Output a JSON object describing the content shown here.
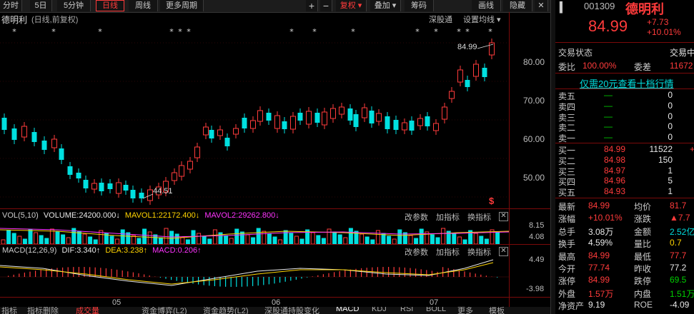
{
  "toolbar": {
    "buttons": [
      "分时",
      "5日",
      "5分钟",
      "日线",
      "周线",
      "更多周期"
    ],
    "plus": "+",
    "minus": "−",
    "right_buttons": [
      "复权",
      "叠加",
      "筹码",
      "画线",
      "隐藏"
    ],
    "close": "✕"
  },
  "chart_header": {
    "name": "德明利",
    "mode": "(日线,前复权)",
    "shenguo": "深股通",
    "set_ma": "设置均线"
  },
  "price_axis": [
    "80.00",
    "70.00",
    "60.00",
    "50.00"
  ],
  "annotations": {
    "high": "84.99",
    "low": "44.51",
    "marker_glyph": "*",
    "right_marker": "$"
  },
  "volume_panel": {
    "label": "VOL(5,10)",
    "volume": "VOLUME:24200.000",
    "mavol1": "MAVOL1:22172.400",
    "mavol2": "MAVOL2:29262.800",
    "arrow_down": "↓",
    "buttons": [
      "改参数",
      "加指标",
      "换指标"
    ],
    "axis_top": "8.15",
    "axis_mid": "4.08"
  },
  "macd_panel": {
    "label": "MACD(12,26,9)",
    "dif": "DIF:3.340",
    "dea": "DEA:3.238",
    "macd": "MACD:0.206",
    "arrow_up": "↑",
    "buttons": [
      "改参数",
      "加指标",
      "换指标"
    ],
    "axis_top": "4.49",
    "axis_bottom": "-3.98"
  },
  "x_axis": [
    "05",
    "06",
    "07"
  ],
  "bottom_tabs": [
    "指标",
    "指标删除",
    "成交量",
    "资金博弈(L2)",
    "资金趋势(L2)",
    "深股通持股变化",
    "MACD",
    "KDJ",
    "RSI",
    "BOLL",
    "更多",
    "模板"
  ],
  "quote": {
    "code": "001309",
    "name": "德明利",
    "price": "84.99",
    "change": "+7.73",
    "change_pct": "+10.01%",
    "status_label": "交易状态",
    "status_value": "交易中",
    "weibi_label": "委比",
    "weibi_value": "100.00%",
    "weicha_label": "委差",
    "weicha_value": "11672",
    "promo": "仅需20元查看十档行情",
    "sells": [
      {
        "label": "卖五",
        "price": "—",
        "vol": "0"
      },
      {
        "label": "卖四",
        "price": "—",
        "vol": "0"
      },
      {
        "label": "卖三",
        "price": "—",
        "vol": "0"
      },
      {
        "label": "卖二",
        "price": "—",
        "vol": "0"
      },
      {
        "label": "卖一",
        "price": "—",
        "vol": "0"
      }
    ],
    "buys": [
      {
        "label": "买一",
        "price": "84.99",
        "vol": "11522",
        "extra": "+"
      },
      {
        "label": "买二",
        "price": "84.98",
        "vol": "150",
        "extra": ""
      },
      {
        "label": "买三",
        "price": "84.97",
        "vol": "1",
        "extra": ""
      },
      {
        "label": "买四",
        "price": "84.96",
        "vol": "5",
        "extra": ""
      },
      {
        "label": "买五",
        "price": "84.93",
        "vol": "1",
        "extra": ""
      }
    ],
    "stats": [
      {
        "l1": "最新",
        "v1": "84.99",
        "c1": "red",
        "l2": "均价",
        "v2": "81.7",
        "c2": "red"
      },
      {
        "l1": "涨幅",
        "v1": "+10.01%",
        "c1": "red",
        "l2": "涨跌",
        "v2": "▲7.7",
        "c2": "red"
      },
      {
        "l1": "总手",
        "v1": "3.08万",
        "c1": "wht",
        "l2": "金额",
        "v2": "2.52亿",
        "c2": "cya"
      },
      {
        "l1": "换手",
        "v1": "4.59%",
        "c1": "wht",
        "l2": "量比",
        "v2": "0.7",
        "c2": "yel"
      },
      {
        "l1": "最高",
        "v1": "84.99",
        "c1": "red",
        "l2": "最低",
        "v2": "77.7",
        "c2": "red"
      },
      {
        "l1": "今开",
        "v1": "77.74",
        "c1": "red",
        "l2": "昨收",
        "v2": "77.2",
        "c2": "wht"
      },
      {
        "l1": "涨停",
        "v1": "84.99",
        "c1": "red",
        "l2": "跌停",
        "v2": "69.5",
        "c2": "grn"
      },
      {
        "l1": "外盘",
        "v1": "1.57万",
        "c1": "red",
        "l2": "内盘",
        "v2": "1.51万",
        "c2": "grn"
      },
      {
        "l1": "净资产",
        "v1": "9.19",
        "c1": "wht",
        "l2": "ROE",
        "v2": "-4.09",
        "c2": "wht"
      }
    ]
  },
  "colors": {
    "up": "#ff3b3b",
    "down": "#00e0e0",
    "dif": "#e8e8e8",
    "dea": "#ffd400",
    "macd": "#ff33ff",
    "bg": "#000000",
    "grid": "#7a0a0a"
  }
}
